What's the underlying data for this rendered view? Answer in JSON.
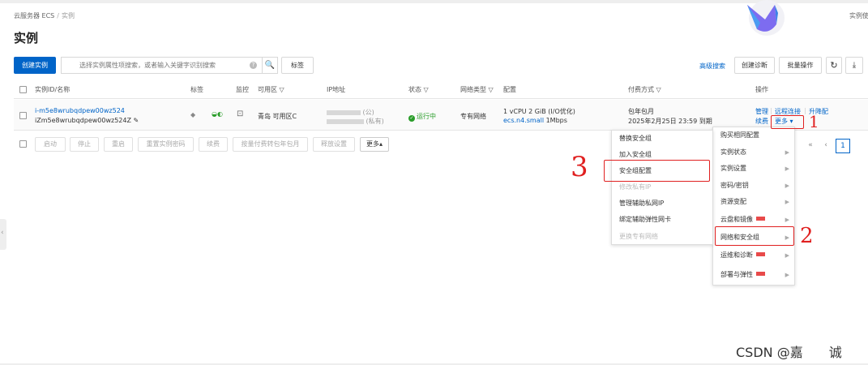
{
  "breadcrumb": {
    "root": "云服务器 ECS",
    "sep": "/",
    "current": "实例"
  },
  "page_title": "实例",
  "top_right_text": "实例使",
  "toolbar": {
    "create_label": "创建实例",
    "search_placeholder": "选择实例属性项搜索，或者输入关键字识别搜索",
    "search_icon": "🔍",
    "tag_label": "标签",
    "advanced_search": "高级搜索",
    "diagnose_label": "创建诊断",
    "batch_label": "批量操作",
    "refresh_icon": "↻",
    "download_icon": "⤓"
  },
  "table": {
    "headers": {
      "id": "实例ID/名称",
      "tag": "标签",
      "monitor": "监控",
      "zone": "可用区",
      "ip": "IP地址",
      "status": "状态",
      "network": "网络类型",
      "config": "配置",
      "pay": "付费方式",
      "ops": "操作"
    },
    "row": {
      "id": "i-m5e8wrubqdpew00wz524",
      "name": "iZm5e8wrubqdpew00wz524Z",
      "zone": "青岛 可用区C",
      "ip_public": "(公)",
      "ip_private": "(私有)",
      "status": "运行中",
      "network": "专有网络",
      "cpu": "1 vCPU 2 GiB",
      "io": "(I/O优化)",
      "spec": "ecs.n4.small",
      "bandwidth": "1Mbps",
      "pay_type": "包年包月",
      "expire": "2025年2月25日 23:59 到期",
      "op_manage": "管理",
      "op_remote": "远程连接",
      "op_upgrade": "升降配",
      "op_renew": "续费",
      "op_more": "更多"
    }
  },
  "bottom_bar": {
    "buttons": [
      "启动",
      "停止",
      "重启",
      "重置实例密码",
      "续费",
      "按量付费转包年包月",
      "释放设置"
    ],
    "more": "更多"
  },
  "pager": {
    "first": "«",
    "prev": "‹",
    "current": "1"
  },
  "menu_right": {
    "items": [
      {
        "label": "购买相同配置",
        "arrow": false,
        "badge": false
      },
      {
        "label": "实例状态",
        "arrow": true,
        "badge": false
      },
      {
        "label": "实例设置",
        "arrow": true,
        "badge": false
      },
      {
        "label": "密码/密钥",
        "arrow": true,
        "badge": false
      },
      {
        "label": "资源变配",
        "arrow": true,
        "badge": false
      },
      {
        "label": "云盘和镜像",
        "arrow": true,
        "badge": true
      },
      {
        "label": "网络和安全组",
        "arrow": true,
        "badge": false
      },
      {
        "label": "运维和诊断",
        "arrow": true,
        "badge": true
      },
      {
        "label": "部署与弹性",
        "arrow": true,
        "badge": true
      }
    ]
  },
  "menu_left": {
    "items": [
      {
        "label": "替换安全组",
        "disabled": false
      },
      {
        "label": "加入安全组",
        "disabled": false
      },
      {
        "label": "安全组配置",
        "disabled": false
      },
      {
        "label": "修改私有IP",
        "disabled": true
      },
      {
        "label": "管理辅助私网IP",
        "disabled": false
      },
      {
        "label": "绑定辅助弹性网卡",
        "disabled": false
      },
      {
        "label": "更换专有网络",
        "disabled": true
      }
    ]
  },
  "annotations": {
    "one": "1",
    "two": "2",
    "three": "3"
  },
  "watermark": "CSDN @嘉　　诚",
  "colors": {
    "primary": "#0064c8",
    "annotation": "#e02020",
    "success": "#2a9d2a"
  }
}
